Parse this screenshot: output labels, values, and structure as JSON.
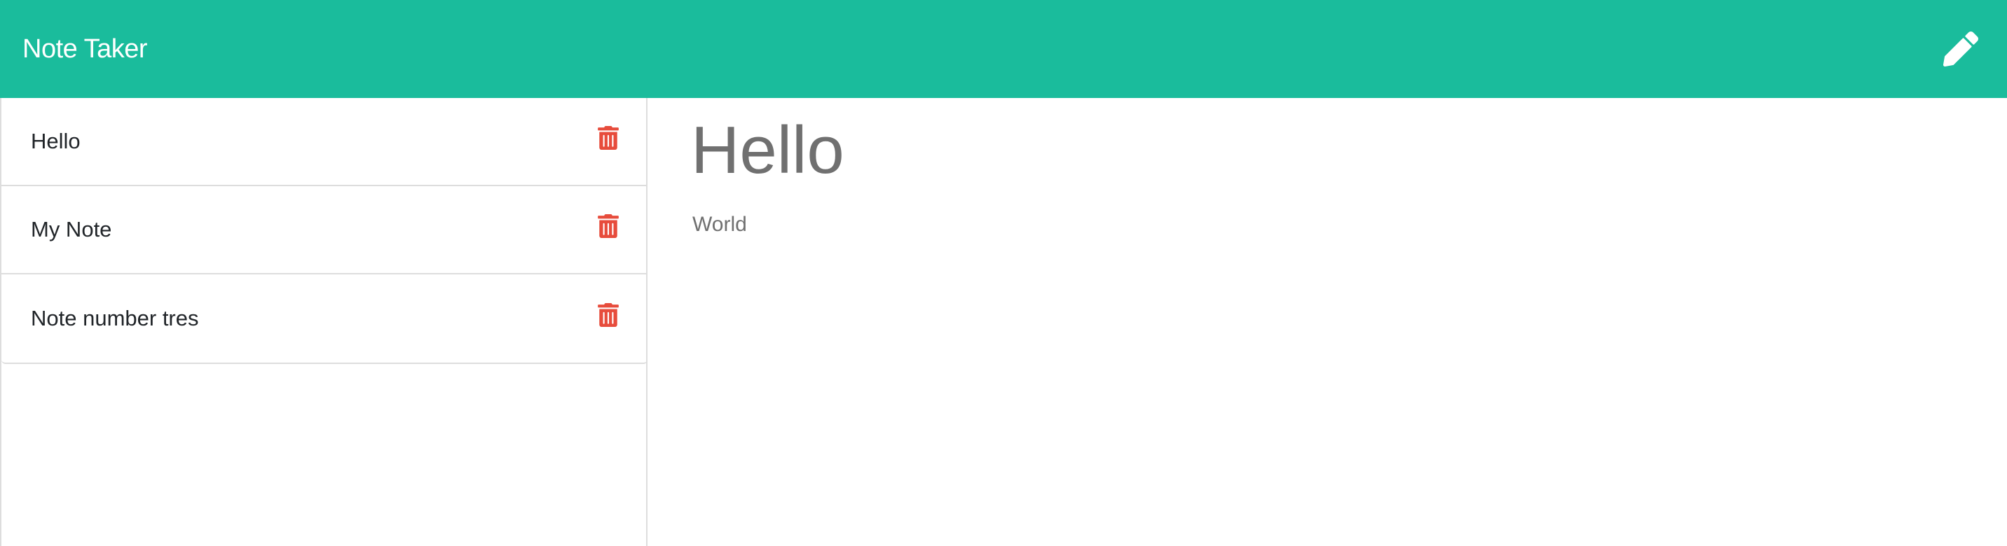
{
  "navbar": {
    "brand": "Note Taker",
    "new_note_icon": "pencil-icon"
  },
  "colors": {
    "navbar_bg": "#1abc9c",
    "delete_icon": "#e74c3c",
    "note_text": "#707070"
  },
  "notes": [
    {
      "title": "Hello",
      "delete_icon": "trash-icon"
    },
    {
      "title": "My Note",
      "delete_icon": "trash-icon"
    },
    {
      "title": "Note number tres",
      "delete_icon": "trash-icon"
    }
  ],
  "active_note": {
    "title": "Hello",
    "text": "World"
  }
}
